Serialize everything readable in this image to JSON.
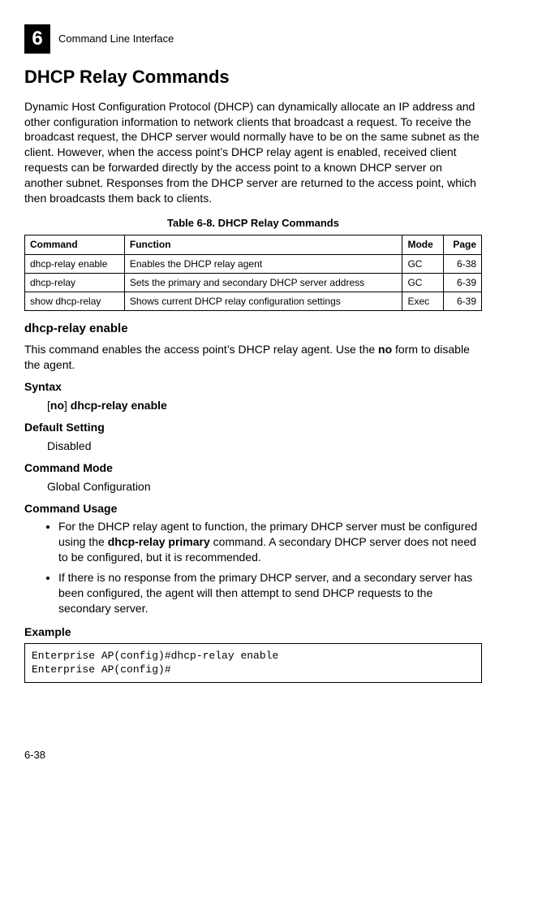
{
  "header": {
    "chapter_num": "6",
    "section": "Command Line Interface"
  },
  "title": "DHCP Relay Commands",
  "intro": "Dynamic Host Configuration Protocol (DHCP) can dynamically allocate an IP address and other configuration information to network clients that broadcast a request. To receive the broadcast request, the DHCP server would normally have to be on the same subnet as the client. However, when the access point’s DHCP relay agent is enabled, received client requests can be forwarded directly by the access point to a known DHCP server on another subnet. Responses from the DHCP server are returned to the access point, which then broadcasts them back to clients.",
  "table": {
    "caption": "Table 6-8. DHCP Relay Commands",
    "headers": {
      "cmd": "Command",
      "func": "Function",
      "mode": "Mode",
      "page": "Page"
    },
    "rows": [
      {
        "cmd": "dhcp-relay enable",
        "func": "Enables the DHCP relay agent",
        "mode": "GC",
        "page": "6-38"
      },
      {
        "cmd": "dhcp-relay",
        "func": "Sets the primary and secondary DHCP server address",
        "mode": "GC",
        "page": "6-39"
      },
      {
        "cmd": "show dhcp-relay",
        "func": "Shows current DHCP relay configuration settings",
        "mode": "Exec",
        "page": "6-39"
      }
    ]
  },
  "command": {
    "name": "dhcp-relay enable",
    "desc_pre": "This command enables the access point’s DHCP relay agent. Use the ",
    "desc_bold": "no",
    "desc_post": " form to disable the agent.",
    "syntax_label": "Syntax",
    "syntax_br1": "[",
    "syntax_no": "no",
    "syntax_br2": "] ",
    "syntax_cmd": "dhcp-relay enable",
    "default_label": "Default Setting",
    "default_value": "Disabled",
    "mode_label": "Command Mode",
    "mode_value": "Global Configuration",
    "usage_label": "Command Usage",
    "usage": {
      "b1_pre": "For the DHCP relay agent to function, the primary DHCP server must be configured using the ",
      "b1_bold": "dhcp-relay primary",
      "b1_post": " command. A secondary DHCP server does not need to be configured, but it is recommended.",
      "b2": "If there is no response from the primary DHCP server, and a secondary server has been configured, the agent will then attempt to send DHCP requests to the secondary server."
    },
    "example_label": "Example",
    "example_text": "Enterprise AP(config)#dhcp-relay enable\nEnterprise AP(config)#"
  },
  "footer": {
    "page": "6-38"
  }
}
